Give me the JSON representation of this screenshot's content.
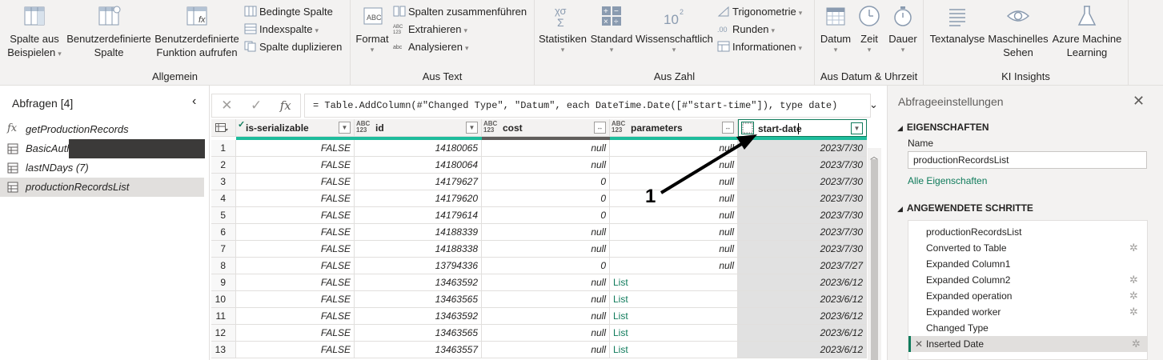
{
  "ribbon": {
    "groups": {
      "allgemein": {
        "label": "Allgemein",
        "spalte_aus_beispielen": "Spalte aus\nBeispielen",
        "benutzerdef_spalte": "Benutzerdefinierte\nSpalte",
        "benutzerdef_funktion": "Benutzerdefinierte\nFunktion aufrufen",
        "bedingte_spalte": "Bedingte Spalte",
        "indexspalte": "Indexspalte",
        "spalte_duplizieren": "Spalte duplizieren"
      },
      "aus_text": {
        "label": "Aus Text",
        "format": "Format",
        "spalten_zusammen": "Spalten zusammenführen",
        "extrahieren": "Extrahieren",
        "analysieren": "Analysieren"
      },
      "aus_zahl": {
        "label": "Aus Zahl",
        "statistiken": "Statistiken",
        "standard": "Standard",
        "wissenschaftlich": "Wissenschaftlich",
        "trigonometrie": "Trigonometrie",
        "runden": "Runden",
        "informationen": "Informationen"
      },
      "aus_datum": {
        "label": "Aus Datum & Uhrzeit",
        "datum": "Datum",
        "zeit": "Zeit",
        "dauer": "Dauer"
      },
      "ki": {
        "label": "KI Insights",
        "textanalyse": "Textanalyse",
        "maschinelles_sehen": "Maschinelles\nSehen",
        "azure_ml": "Azure Machine\nLearning"
      }
    }
  },
  "queries": {
    "title": "Abfragen [4]",
    "items": [
      {
        "label": "getProductionRecords",
        "icon": "function-icon"
      },
      {
        "label": "BasicAuth",
        "icon": "table-icon"
      },
      {
        "label": "lastNDays (7)",
        "icon": "table-icon"
      },
      {
        "label": "productionRecordsList",
        "icon": "table-icon"
      }
    ]
  },
  "formula": {
    "text": "= Table.AddColumn(#\"Changed Type\", \"Datum\", each DateTime.Date([#\"start-time\"]), type date)"
  },
  "table": {
    "columns": [
      {
        "name": "is-serializable",
        "type": "✓"
      },
      {
        "name": "id",
        "type": "ABC\n123"
      },
      {
        "name": "cost",
        "type": "ABC\n123"
      },
      {
        "name": "parameters",
        "type": "ABC\n123"
      },
      {
        "name": "start-date",
        "type": "date"
      }
    ],
    "rows": [
      {
        "n": "1",
        "ser": "FALSE",
        "id": "14180065",
        "cost": "null",
        "param": "null",
        "date": "2023/7/30"
      },
      {
        "n": "2",
        "ser": "FALSE",
        "id": "14180064",
        "cost": "null",
        "param": "null",
        "date": "2023/7/30"
      },
      {
        "n": "3",
        "ser": "FALSE",
        "id": "14179627",
        "cost": "0",
        "param": "null",
        "date": "2023/7/30"
      },
      {
        "n": "4",
        "ser": "FALSE",
        "id": "14179620",
        "cost": "0",
        "param": "null",
        "date": "2023/7/30"
      },
      {
        "n": "5",
        "ser": "FALSE",
        "id": "14179614",
        "cost": "0",
        "param": "null",
        "date": "2023/7/30"
      },
      {
        "n": "6",
        "ser": "FALSE",
        "id": "14188339",
        "cost": "null",
        "param": "null",
        "date": "2023/7/30"
      },
      {
        "n": "7",
        "ser": "FALSE",
        "id": "14188338",
        "cost": "null",
        "param": "null",
        "date": "2023/7/30"
      },
      {
        "n": "8",
        "ser": "FALSE",
        "id": "13794336",
        "cost": "0",
        "param": "null",
        "date": "2023/7/27"
      },
      {
        "n": "9",
        "ser": "FALSE",
        "id": "13463592",
        "cost": "null",
        "param": "List",
        "date": "2023/6/12"
      },
      {
        "n": "10",
        "ser": "FALSE",
        "id": "13463565",
        "cost": "null",
        "param": "List",
        "date": "2023/6/12"
      },
      {
        "n": "11",
        "ser": "FALSE",
        "id": "13463592",
        "cost": "null",
        "param": "List",
        "date": "2023/6/12"
      },
      {
        "n": "12",
        "ser": "FALSE",
        "id": "13463565",
        "cost": "null",
        "param": "List",
        "date": "2023/6/12"
      },
      {
        "n": "13",
        "ser": "FALSE",
        "id": "13463557",
        "cost": "null",
        "param": "List",
        "date": "2023/6/12"
      }
    ]
  },
  "settings": {
    "title": "Abfrageeinstellungen",
    "eigenschaften": "EIGENSCHAFTEN",
    "name_label": "Name",
    "name_value": "productionRecordsList",
    "alle_eigenschaften": "Alle Eigenschaften",
    "schritte_title": "ANGEWENDETE SCHRITTE",
    "steps": [
      {
        "label": "productionRecordsList",
        "gear": false
      },
      {
        "label": "Converted to Table",
        "gear": true
      },
      {
        "label": "Expanded Column1",
        "gear": false
      },
      {
        "label": "Expanded Column2",
        "gear": true
      },
      {
        "label": "Expanded operation",
        "gear": true
      },
      {
        "label": "Expanded worker",
        "gear": true
      },
      {
        "label": "Changed Type",
        "gear": false
      },
      {
        "label": "Inserted Date",
        "gear": true
      }
    ]
  },
  "annotation": {
    "number": "1"
  },
  "colors": {
    "accent": "#0f7b5b",
    "quality_green": "#1ebc9c"
  }
}
